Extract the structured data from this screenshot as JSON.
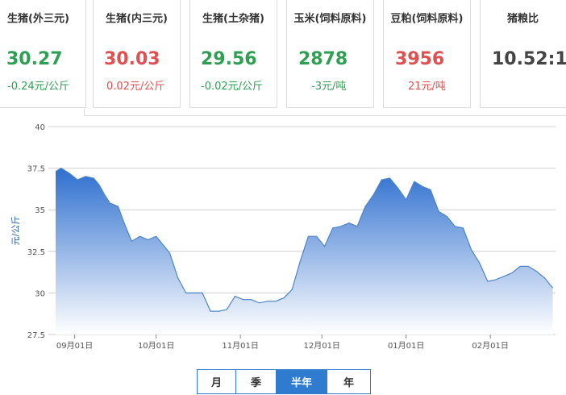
{
  "cards": [
    {
      "name": "生猪(外三元)",
      "price": "30.27",
      "change": "-0.24元/公斤",
      "dir": "down"
    },
    {
      "name": "生猪(内三元)",
      "price": "30.03",
      "change": "0.02元/公斤",
      "dir": "up"
    },
    {
      "name": "生猪(土杂猪)",
      "price": "29.56",
      "change": "-0.02元/公斤",
      "dir": "down"
    },
    {
      "name": "玉米(饲料原料)",
      "price": "2878",
      "change": "-3元/吨",
      "dir": "down"
    },
    {
      "name": "豆粕(饲料原料)",
      "price": "3956",
      "change": "21元/吨",
      "dir": "up"
    },
    {
      "name": "猪粮比",
      "price": "10.52:1",
      "change": "",
      "dir": "neutral"
    }
  ],
  "range_buttons": {
    "month": "月",
    "quarter": "季",
    "half_year": "半年",
    "year": "年",
    "active": "half_year"
  },
  "colors": {
    "line": "#4d84c9",
    "area_top": "#2e6fcf",
    "area_bottom": "#ffffff",
    "grid": "#cfcfcf",
    "accent": "#2e7bd0",
    "up": "#e05050",
    "down": "#2fa053"
  },
  "chart_data": {
    "type": "area",
    "ylabel": "元/公斤",
    "ylim": [
      27.5,
      40
    ],
    "yticks": [
      "27.5",
      "30",
      "32.5",
      "35",
      "37.5",
      "40"
    ],
    "xticks": [
      "09月01日",
      "10月01日",
      "11月01日",
      "12月01日",
      "01月01日",
      "02月01日"
    ],
    "xlim": [
      "08月25日",
      "02月25日"
    ],
    "grid": true,
    "series": [
      {
        "x": [
          "08月25日",
          "08月27日",
          "08月30日",
          "09月02日",
          "09月05日",
          "09月08日",
          "09月10日",
          "09月12日",
          "09月14日",
          "09月17日",
          "09月19日",
          "09月22日",
          "09月25日",
          "09月28日",
          "10月01日",
          "10月03日",
          "10月06日",
          "10月09日",
          "10月12日",
          "10月15日",
          "10月18日",
          "10月21日",
          "10月24日",
          "10月27日",
          "10月30日",
          "11月02日",
          "11月05日",
          "11月08日",
          "11月11日",
          "11月14日",
          "11月17日",
          "11月20日",
          "11月23日",
          "11月26日",
          "11月29日",
          "12月02日",
          "12月05日",
          "12月08日",
          "12月11日",
          "12月14日",
          "12月17日",
          "12月20日",
          "12月23日",
          "12月26日",
          "12月29日",
          "01月01日",
          "01月04日",
          "01月07日",
          "01月10日",
          "01月13日",
          "01月16日",
          "01月19日",
          "01月22日",
          "01月25日",
          "01月28日",
          "01月31日",
          "02月03日",
          "02月06日",
          "02月09日",
          "02月12日",
          "02月15日",
          "02月18日",
          "02月21日",
          "02月24日"
        ],
        "y": [
          37.3,
          37.5,
          37.2,
          36.8,
          37.0,
          36.9,
          36.5,
          35.9,
          35.4,
          35.2,
          34.3,
          33.1,
          33.4,
          33.2,
          33.4,
          33.0,
          32.4,
          30.9,
          30.0,
          30.0,
          30.0,
          28.9,
          28.9,
          29.0,
          29.8,
          29.6,
          29.6,
          29.4,
          29.5,
          29.5,
          29.7,
          30.2,
          31.9,
          33.4,
          33.4,
          32.8,
          33.9,
          34.0,
          34.2,
          34.0,
          35.2,
          35.9,
          36.8,
          36.9,
          36.3,
          35.6,
          36.7,
          36.4,
          36.2,
          34.9,
          34.6,
          34.0,
          33.9,
          32.6,
          31.8,
          30.7,
          30.8,
          31.0,
          31.2,
          31.6,
          31.6,
          31.3,
          30.9,
          30.3
        ]
      }
    ]
  }
}
